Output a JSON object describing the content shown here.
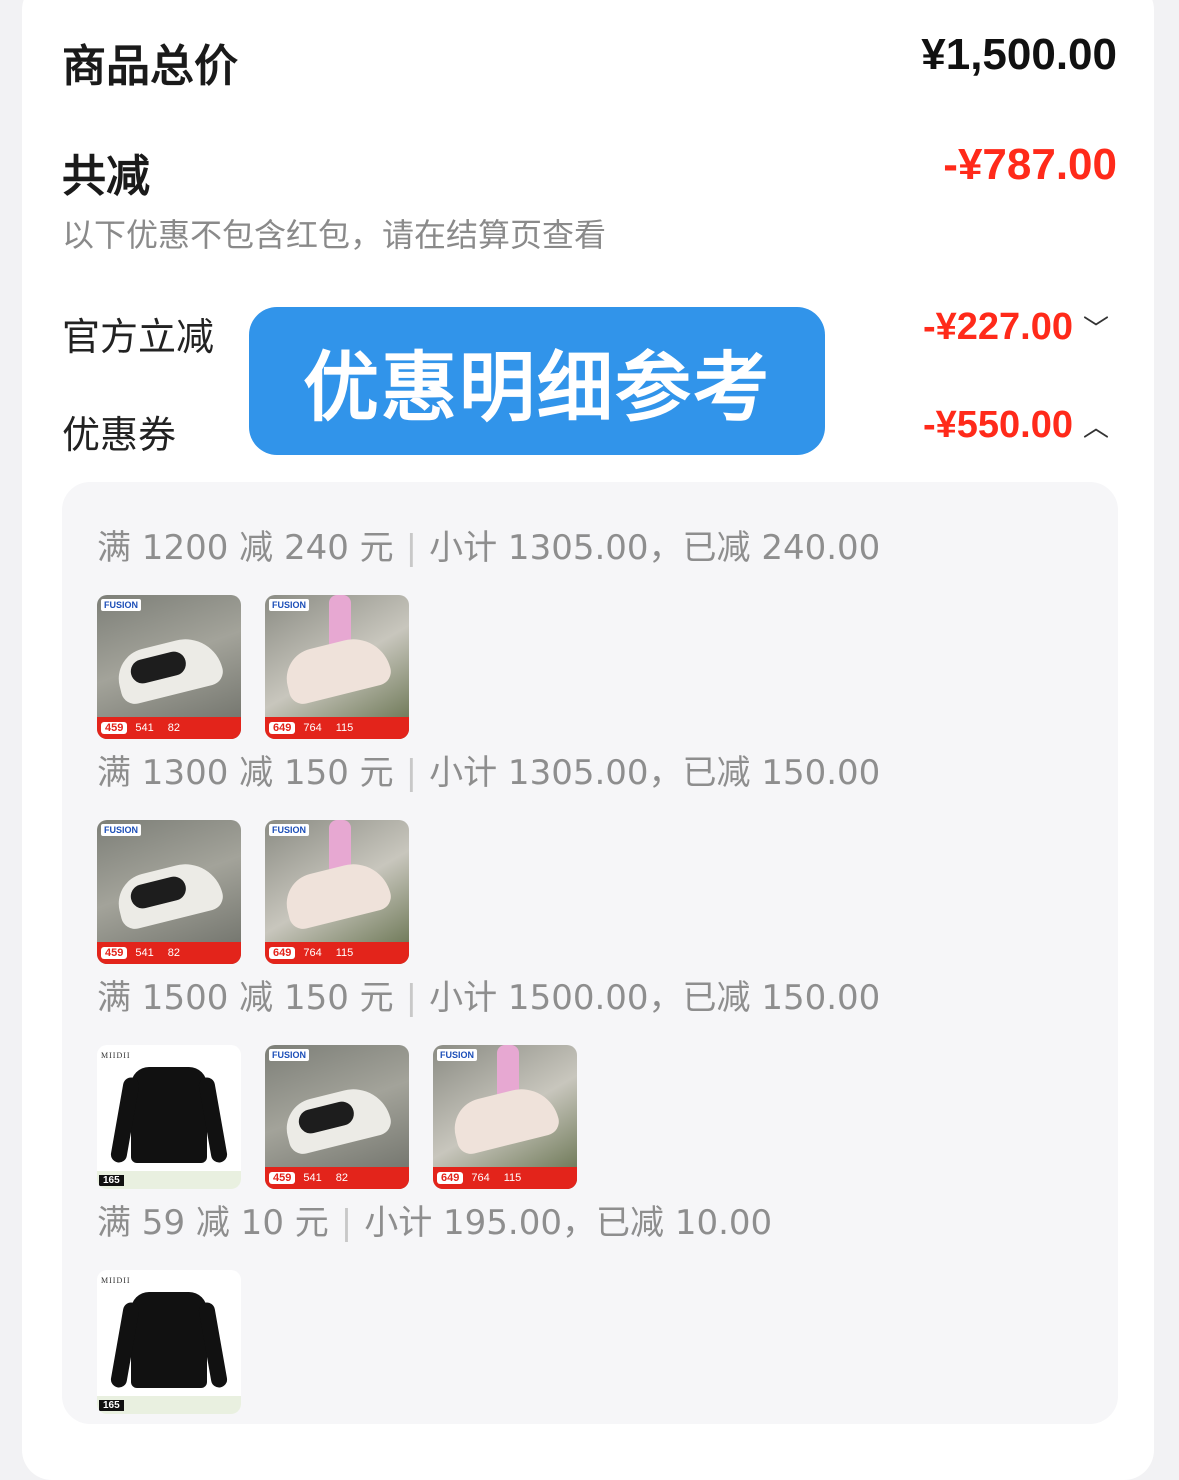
{
  "summary": {
    "total_label": "商品总价",
    "total_value": "¥1,500.00",
    "reduce_label": "共减",
    "reduce_value": "-¥787.00",
    "note": "以下优惠不包含红包，请在结算页查看",
    "official_label": "官方立减",
    "official_value": "-¥227.00",
    "coupon_label": "优惠券",
    "coupon_value": "-¥550.00"
  },
  "overlay": {
    "text": "优惠明细参考"
  },
  "groups": [
    {
      "rule": "满 1200 减 240 元",
      "subtotal": "小计 1305.00，已减 240.00"
    },
    {
      "rule": "满 1300 减 150 元",
      "subtotal": "小计 1305.00，已减 150.00"
    },
    {
      "rule": "满 1500 减 150 元",
      "subtotal": "小计 1500.00，已减 150.00"
    },
    {
      "rule": "满 59 减 10 元",
      "subtotal": "小计 195.00，已减 10.00"
    }
  ],
  "thumbs": {
    "brand": "FUSION",
    "shirt_brand": "MIIDII",
    "shoe_a_prices": [
      "459",
      "541",
      "82"
    ],
    "shoe_b_prices": [
      "649",
      "764",
      "115"
    ],
    "shirt_price": "165"
  },
  "icons": {
    "expand": "chevron-down-icon",
    "collapse": "chevron-up-icon"
  },
  "colors": {
    "accent_red": "#ff2a1a",
    "banner_blue": "#3194ea"
  }
}
